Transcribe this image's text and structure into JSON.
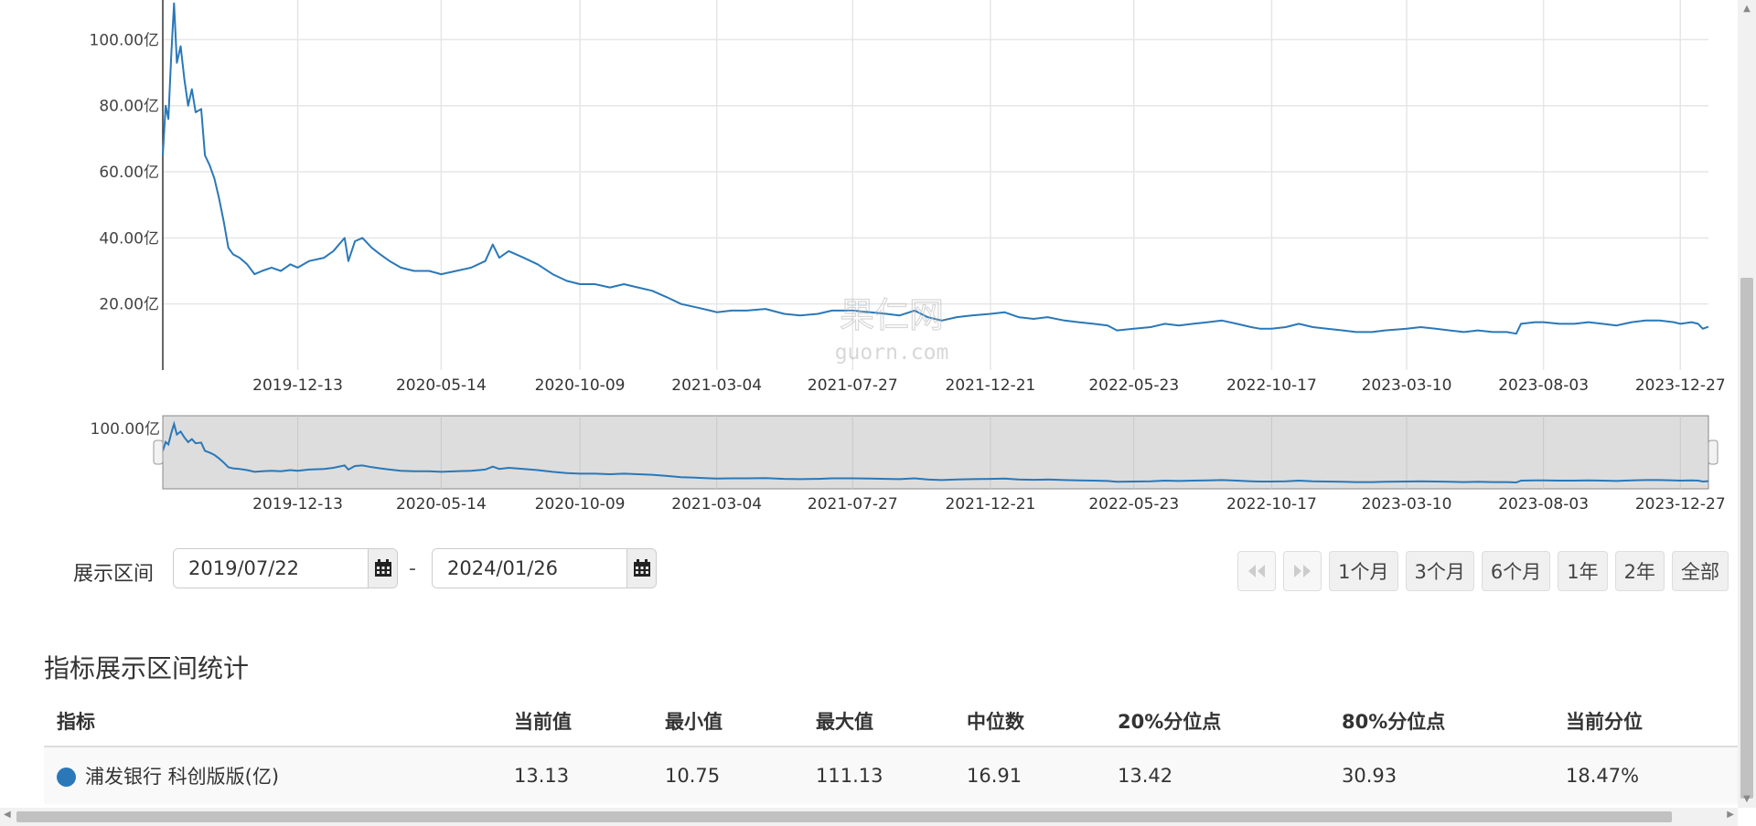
{
  "chart_data": {
    "type": "line",
    "x_tick_labels": [
      "2019-12-13",
      "2020-05-14",
      "2020-10-09",
      "2021-03-04",
      "2021-07-27",
      "2021-12-21",
      "2022-05-23",
      "2022-10-17",
      "2023-03-10",
      "2023-08-03",
      "2023-12-27"
    ],
    "y_tick_labels": [
      "20.00亿",
      "40.00亿",
      "60.00亿",
      "80.00亿",
      "100.00亿"
    ],
    "y_ticks": [
      20,
      40,
      60,
      80,
      100
    ],
    "ylim": [
      0,
      112
    ],
    "navigator_y_tick_label": "100.00亿",
    "navigator_ylim": [
      0,
      125
    ],
    "x_range": [
      "2019-07-22",
      "2024-01-26"
    ],
    "grid": true,
    "series": [
      {
        "name": "浦发银行 科创版版(亿)",
        "color": "#2a78b8",
        "points": [
          [
            "2019-07-22",
            65
          ],
          [
            "2019-07-25",
            80
          ],
          [
            "2019-07-28",
            76
          ],
          [
            "2019-07-31",
            95
          ],
          [
            "2019-08-03",
            111
          ],
          [
            "2019-08-06",
            93
          ],
          [
            "2019-08-10",
            98
          ],
          [
            "2019-08-14",
            88
          ],
          [
            "2019-08-18",
            80
          ],
          [
            "2019-08-22",
            85
          ],
          [
            "2019-08-26",
            78
          ],
          [
            "2019-09-01",
            79
          ],
          [
            "2019-09-05",
            65
          ],
          [
            "2019-09-10",
            62
          ],
          [
            "2019-09-15",
            58
          ],
          [
            "2019-09-20",
            52
          ],
          [
            "2019-09-25",
            45
          ],
          [
            "2019-09-30",
            37
          ],
          [
            "2019-10-05",
            35
          ],
          [
            "2019-10-12",
            34
          ],
          [
            "2019-10-20",
            32
          ],
          [
            "2019-10-28",
            29
          ],
          [
            "2019-11-05",
            30
          ],
          [
            "2019-11-15",
            31
          ],
          [
            "2019-11-25",
            30
          ],
          [
            "2019-12-05",
            32
          ],
          [
            "2019-12-13",
            31
          ],
          [
            "2019-12-25",
            33
          ],
          [
            "2020-01-10",
            34
          ],
          [
            "2020-01-20",
            36
          ],
          [
            "2020-02-01",
            40
          ],
          [
            "2020-02-05",
            33
          ],
          [
            "2020-02-12",
            39
          ],
          [
            "2020-02-20",
            40
          ],
          [
            "2020-03-01",
            37
          ],
          [
            "2020-03-10",
            35
          ],
          [
            "2020-03-20",
            33
          ],
          [
            "2020-04-01",
            31
          ],
          [
            "2020-04-15",
            30
          ],
          [
            "2020-05-01",
            30
          ],
          [
            "2020-05-14",
            29
          ],
          [
            "2020-05-30",
            30
          ],
          [
            "2020-06-15",
            31
          ],
          [
            "2020-06-30",
            33
          ],
          [
            "2020-07-08",
            38
          ],
          [
            "2020-07-15",
            34
          ],
          [
            "2020-07-25",
            36
          ],
          [
            "2020-08-10",
            34
          ],
          [
            "2020-08-25",
            32
          ],
          [
            "2020-09-10",
            29
          ],
          [
            "2020-09-25",
            27
          ],
          [
            "2020-10-09",
            26
          ],
          [
            "2020-10-25",
            26
          ],
          [
            "2020-11-10",
            25
          ],
          [
            "2020-11-25",
            26
          ],
          [
            "2020-12-10",
            25
          ],
          [
            "2020-12-25",
            24
          ],
          [
            "2021-01-10",
            22
          ],
          [
            "2021-01-25",
            20
          ],
          [
            "2021-02-10",
            19
          ],
          [
            "2021-02-25",
            18
          ],
          [
            "2021-03-04",
            17.5
          ],
          [
            "2021-03-20",
            18
          ],
          [
            "2021-04-05",
            18
          ],
          [
            "2021-04-25",
            18.5
          ],
          [
            "2021-05-15",
            17
          ],
          [
            "2021-06-01",
            16.5
          ],
          [
            "2021-06-20",
            17
          ],
          [
            "2021-07-05",
            18
          ],
          [
            "2021-07-27",
            18
          ],
          [
            "2021-08-15",
            17.5
          ],
          [
            "2021-09-01",
            17
          ],
          [
            "2021-09-15",
            16.5
          ],
          [
            "2021-10-01",
            18
          ],
          [
            "2021-10-15",
            16
          ],
          [
            "2021-10-30",
            15
          ],
          [
            "2021-11-15",
            16
          ],
          [
            "2021-12-01",
            16.5
          ],
          [
            "2021-12-21",
            17
          ],
          [
            "2022-01-05",
            17.5
          ],
          [
            "2022-01-20",
            16
          ],
          [
            "2022-02-05",
            15.5
          ],
          [
            "2022-02-20",
            16
          ],
          [
            "2022-03-10",
            15
          ],
          [
            "2022-03-25",
            14.5
          ],
          [
            "2022-04-10",
            14
          ],
          [
            "2022-04-25",
            13.5
          ],
          [
            "2022-05-05",
            12
          ],
          [
            "2022-05-23",
            12.5
          ],
          [
            "2022-06-10",
            13
          ],
          [
            "2022-06-25",
            14
          ],
          [
            "2022-07-10",
            13.5
          ],
          [
            "2022-07-25",
            14
          ],
          [
            "2022-08-10",
            14.5
          ],
          [
            "2022-08-25",
            15
          ],
          [
            "2022-09-10",
            14
          ],
          [
            "2022-09-25",
            13
          ],
          [
            "2022-10-05",
            12.5
          ],
          [
            "2022-10-17",
            12.5
          ],
          [
            "2022-11-01",
            13
          ],
          [
            "2022-11-15",
            14
          ],
          [
            "2022-11-30",
            13
          ],
          [
            "2022-12-15",
            12.5
          ],
          [
            "2023-01-01",
            12
          ],
          [
            "2023-01-15",
            11.5
          ],
          [
            "2023-02-01",
            11.5
          ],
          [
            "2023-02-15",
            12
          ],
          [
            "2023-03-10",
            12.5
          ],
          [
            "2023-03-25",
            13
          ],
          [
            "2023-04-10",
            12.5
          ],
          [
            "2023-04-25",
            12
          ],
          [
            "2023-05-10",
            11.5
          ],
          [
            "2023-05-25",
            12
          ],
          [
            "2023-06-10",
            11.5
          ],
          [
            "2023-06-25",
            11.5
          ],
          [
            "2023-07-05",
            11
          ],
          [
            "2023-07-10",
            14
          ],
          [
            "2023-07-25",
            14.5
          ],
          [
            "2023-08-03",
            14.5
          ],
          [
            "2023-08-20",
            14
          ],
          [
            "2023-09-05",
            14
          ],
          [
            "2023-09-20",
            14.5
          ],
          [
            "2023-10-05",
            14
          ],
          [
            "2023-10-20",
            13.5
          ],
          [
            "2023-11-05",
            14.5
          ],
          [
            "2023-11-20",
            15
          ],
          [
            "2023-12-05",
            15
          ],
          [
            "2023-12-20",
            14.5
          ],
          [
            "2023-12-27",
            14
          ],
          [
            "2024-01-08",
            14.5
          ],
          [
            "2024-01-15",
            14
          ],
          [
            "2024-01-20",
            12.5
          ],
          [
            "2024-01-26",
            13.13
          ]
        ]
      }
    ]
  },
  "watermark": {
    "cn": "果仁网",
    "en": "guorn.com"
  },
  "toolbar": {
    "range_label": "展示区间",
    "start_date": "2019/07/22",
    "end_date": "2024/01/26",
    "separator": "-",
    "range_buttons": [
      "1个月",
      "3个月",
      "6个月",
      "1年",
      "2年",
      "全部"
    ]
  },
  "stats": {
    "title": "指标展示区间统计",
    "headers": [
      "指标",
      "当前值",
      "最小值",
      "最大值",
      "中位数",
      "20%分位点",
      "80%分位点",
      "当前分位"
    ],
    "row": {
      "name": "浦发银行 科创版版(亿)",
      "dot_color": "#2a78b8",
      "values": [
        "13.13",
        "10.75",
        "111.13",
        "16.91",
        "13.42",
        "30.93",
        "18.47%"
      ]
    }
  }
}
